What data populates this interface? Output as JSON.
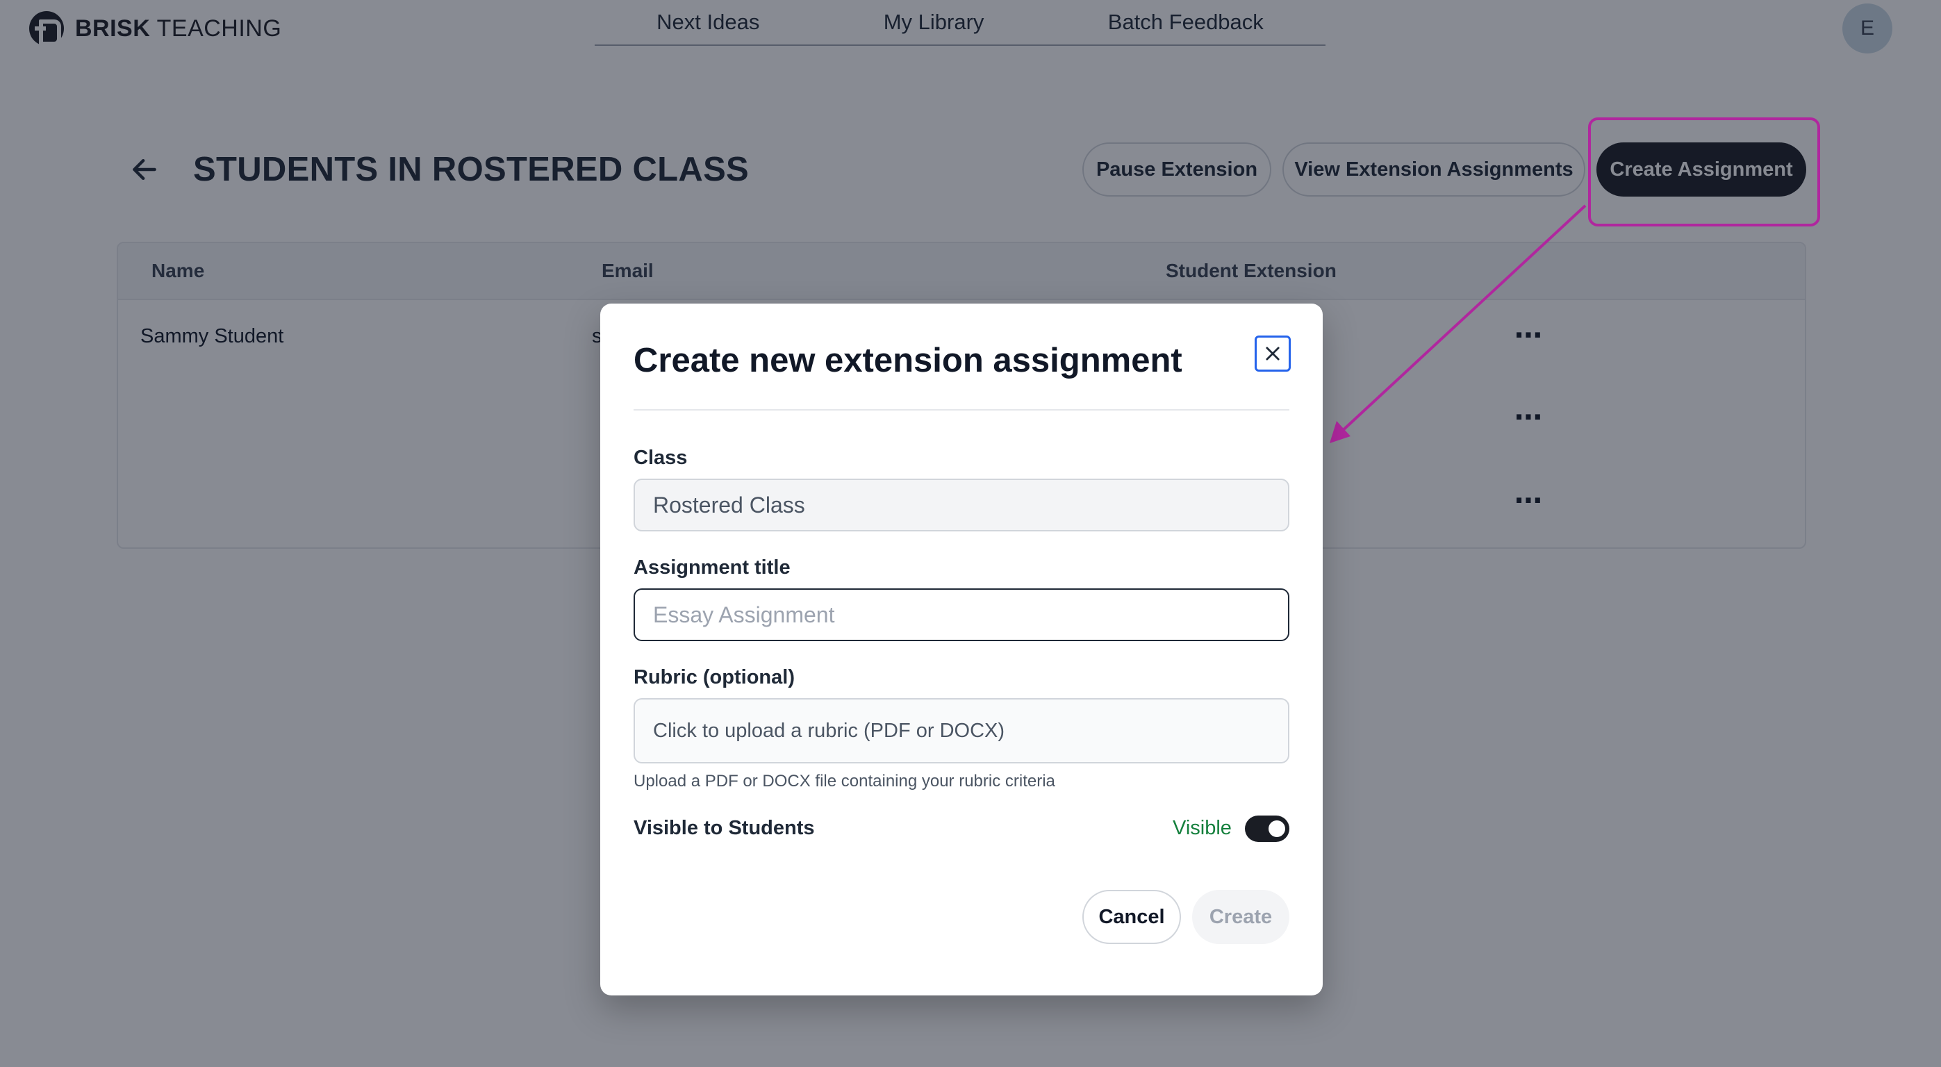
{
  "brand": {
    "bold": "BRISK",
    "rest": " TEACHING"
  },
  "nav": {
    "items": [
      "Next Ideas",
      "My Library",
      "Batch Feedback"
    ]
  },
  "user": {
    "avatar_initial": "E"
  },
  "header": {
    "title": "STUDENTS IN ROSTERED CLASS",
    "pause_label": "Pause Extension",
    "view_label": "View Extension Assignments",
    "create_label": "Create Assignment"
  },
  "table": {
    "columns": [
      "Name",
      "Email",
      "Student Extension"
    ],
    "rows": [
      {
        "name": "Sammy Student",
        "email_fragment": "s"
      }
    ],
    "row_menu_icon": "ellipsis-icon"
  },
  "modal": {
    "title": "Create new extension assignment",
    "class_label": "Class",
    "class_value": "Rostered Class",
    "title_label": "Assignment title",
    "title_placeholder": "Essay Assignment",
    "rubric_label": "Rubric (optional)",
    "rubric_upload_text": "Click to upload a rubric (PDF or DOCX)",
    "rubric_help": "Upload a PDF or DOCX file containing your rubric criteria",
    "visible_label": "Visible to Students",
    "visible_state": "Visible",
    "cancel_label": "Cancel",
    "create_label": "Create"
  },
  "colors": {
    "accent_dark": "#1a1d24",
    "annotation": "#b0279e",
    "visible_green": "#15803d",
    "close_focus": "#2563eb"
  }
}
